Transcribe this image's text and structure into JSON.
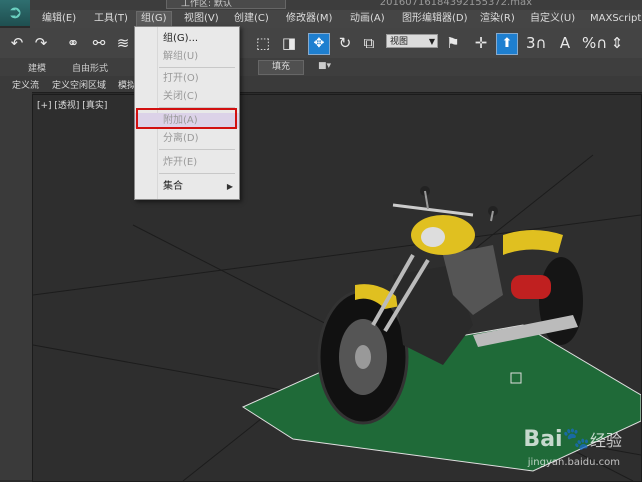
{
  "window": {
    "title": "20160716184392155372.max",
    "workspace": "工作区: 默认"
  },
  "menubar": {
    "items": [
      "编辑(E)",
      "工具(T)",
      "组(G)",
      "视图(V)",
      "创建(C)",
      "修改器(M)",
      "动画(A)",
      "图形编辑器(D)",
      "渲染(R)",
      "自定义(U)",
      "MAXScript(X)"
    ],
    "active_index": 2
  },
  "toolbar": {
    "view_select_value": "视图",
    "snap_label": "3",
    "angle_snap_label": "A",
    "percent_snap_label": "%"
  },
  "ribbon": {
    "tabs": [
      "建模",
      "自由形式"
    ],
    "fill_label": "填充"
  },
  "subbar": {
    "items": [
      "定义流",
      "定义空闲区域",
      "模拟"
    ]
  },
  "viewport": {
    "label": "[+] [透视] [真实]",
    "grid_color": "#1f6a38",
    "bike_color": "#e0c020"
  },
  "group_menu": {
    "items": [
      {
        "label": "组(G)...",
        "enabled": true
      },
      {
        "label": "解组(U)",
        "enabled": false
      },
      {
        "label": "打开(O)",
        "enabled": false
      },
      {
        "label": "关闭(C)",
        "enabled": false
      },
      {
        "label": "附加(A)",
        "enabled": false
      },
      {
        "label": "分离(D)",
        "enabled": false
      },
      {
        "label": "炸开(E)",
        "enabled": false
      },
      {
        "label": "集合",
        "enabled": true
      }
    ]
  },
  "watermark": {
    "brand": "Bai",
    "brand_suffix": "经验",
    "url": "jingyan.baidu.com"
  }
}
